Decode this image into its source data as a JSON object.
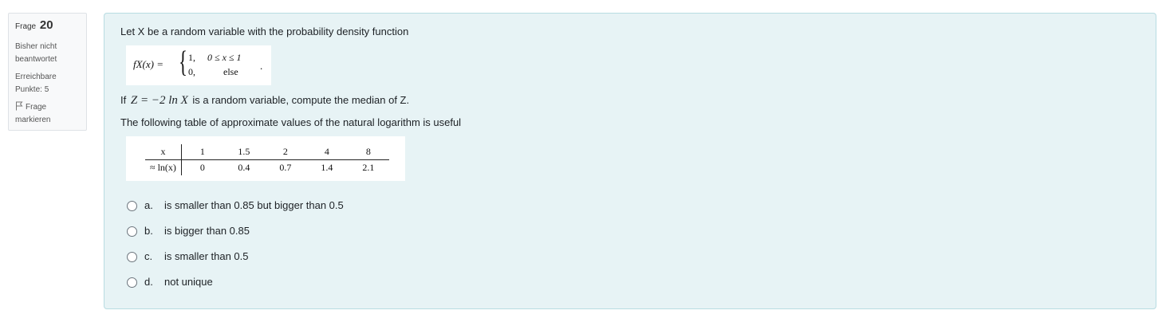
{
  "info": {
    "label": "Frage",
    "number": "20",
    "state_line1": "Bisher nicht",
    "state_line2": "beantwortet",
    "grade_line1": "Erreichbare",
    "grade_line2": "Punkte: 5",
    "flag_line1": "Frage",
    "flag_line2": "markieren"
  },
  "question": {
    "intro": "Let X be a random variable with the probability density function",
    "pdf": {
      "lhs": "fX(x) =",
      "case1_value": "1,",
      "case1_condition": "0 ≤ x ≤ 1",
      "case2_value": "0,",
      "case2_condition": "else",
      "tail": "."
    },
    "task_prefix": "If",
    "task_math": "Z = −2 ln X",
    "task_suffix": "is a random variable, compute the median of Z.",
    "table_intro": "The following table of approximate values of the natural logarithm is useful",
    "table": {
      "row_labels": [
        "x",
        "≈ ln(x)"
      ],
      "x_values": [
        "1",
        "1.5",
        "2",
        "4",
        "8"
      ],
      "ln_values": [
        "0",
        "0.4",
        "0.7",
        "1.4",
        "2.1"
      ]
    }
  },
  "answers": [
    {
      "letter": "a.",
      "text": "is smaller than 0.85 but bigger than 0.5"
    },
    {
      "letter": "b.",
      "text": "is bigger than 0.85"
    },
    {
      "letter": "c.",
      "text": "is smaller than 0.5"
    },
    {
      "letter": "d.",
      "text": "not unique"
    }
  ]
}
